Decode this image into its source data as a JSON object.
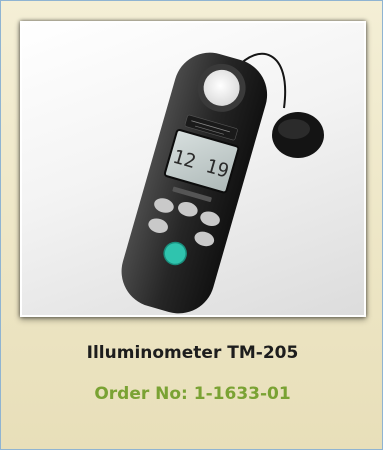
{
  "product": {
    "name": "Illuminometer TM-205",
    "order_number": "Order No: 1-1633-01",
    "display_reading": "12 19",
    "image_icon": "illuminometer-device-photo"
  },
  "colors": {
    "card_background": "#f1ebcf",
    "card_border": "#8fb4d2",
    "order_text": "#7aa233",
    "title_text": "#1d1d1d",
    "lcd_screen": "#c9d3d2",
    "accent_button": "#2fc4ae"
  }
}
